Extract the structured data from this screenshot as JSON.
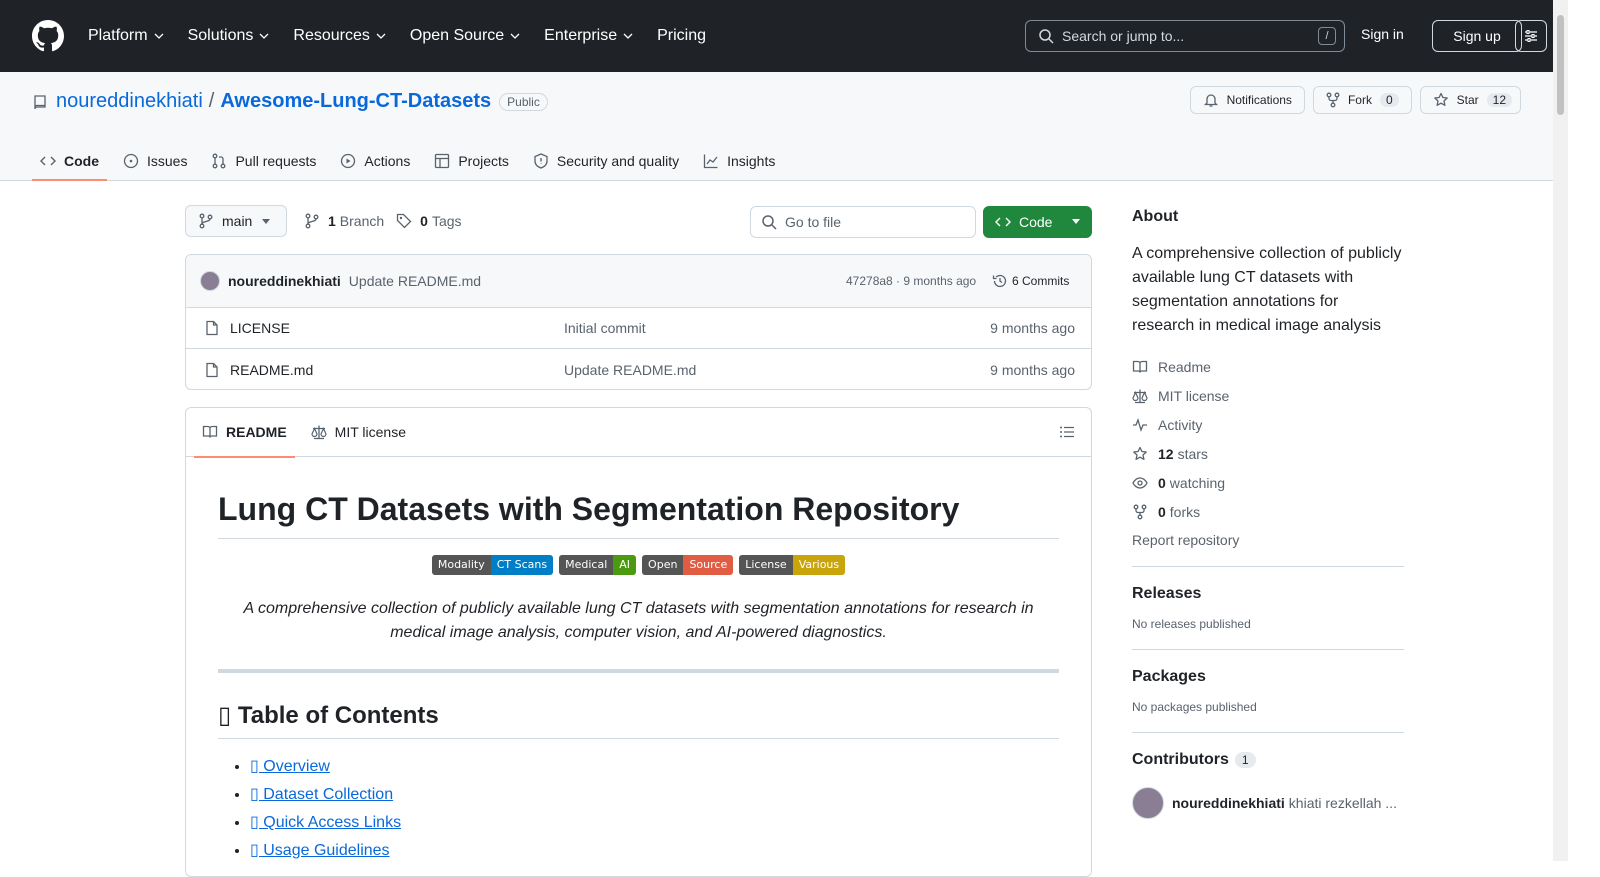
{
  "header": {
    "nav": [
      "Platform",
      "Solutions",
      "Resources",
      "Open Source",
      "Enterprise",
      "Pricing"
    ],
    "search_placeholder": "Search or jump to...",
    "search_shortcut": "/",
    "sign_in": "Sign in",
    "sign_up": "Sign up"
  },
  "repo": {
    "owner": "noureddinekhiati",
    "separator": "/",
    "name": "Awesome-Lung-CT-Datasets",
    "visibility": "Public",
    "notifications_label": "Notifications",
    "fork_label": "Fork",
    "fork_count": "0",
    "star_label": "Star",
    "star_count": "12"
  },
  "tabs": [
    "Code",
    "Issues",
    "Pull requests",
    "Actions",
    "Projects",
    "Security and quality",
    "Insights"
  ],
  "toolbar": {
    "branch": "main",
    "branch_count": "1",
    "branch_label": "Branch",
    "tag_count": "0",
    "tag_label": "Tags",
    "gofile_placeholder": "Go to file",
    "code_button": "Code"
  },
  "latest_commit": {
    "author": "noureddinekhiati",
    "message": "Update README.md",
    "meta": "47278a8 · 9 months ago",
    "commits": "6 Commits"
  },
  "files": [
    {
      "name": "LICENSE",
      "message": "Initial commit",
      "age": "9 months ago"
    },
    {
      "name": "README.md",
      "message": "Update README.md",
      "age": "9 months ago"
    }
  ],
  "readme": {
    "tabs": [
      "README",
      "MIT license"
    ],
    "title": "Lung CT Datasets with Segmentation Repository",
    "badges": [
      {
        "left": "Modality",
        "right": "CT Scans",
        "color": "#007ec6"
      },
      {
        "left": "Medical",
        "right": "AI",
        "color": "#4c9a12"
      },
      {
        "left": "Open",
        "right": "Source",
        "color": "#e05d44"
      },
      {
        "left": "License",
        "right": "Various",
        "color": "#c9a50b"
      }
    ],
    "description": "A comprehensive collection of publicly available lung CT datasets with segmentation annotations for research in medical image analysis, computer vision, and AI-powered diagnostics.",
    "toc_title": "▯ Table of Contents",
    "toc": [
      "▯ Overview",
      "▯ Dataset Collection",
      "▯ Quick Access Links",
      "▯ Usage Guidelines"
    ]
  },
  "sidebar": {
    "about_title": "About",
    "about_text": "A comprehensive collection of publicly available lung CT datasets with segmentation annotations for research in medical image analysis",
    "readme": "Readme",
    "license": "MIT license",
    "activity": "Activity",
    "stars_count": "12",
    "stars_label": "stars",
    "watching_count": "0",
    "watching_label": "watching",
    "forks_count": "0",
    "forks_label": "forks",
    "report": "Report repository",
    "releases_title": "Releases",
    "releases_text": "No releases published",
    "packages_title": "Packages",
    "packages_text": "No packages published",
    "contributors_title": "Contributors",
    "contributors_count": "1",
    "contributor_login": "noureddinekhiati",
    "contributor_name": "khiati rezkellah ..."
  }
}
